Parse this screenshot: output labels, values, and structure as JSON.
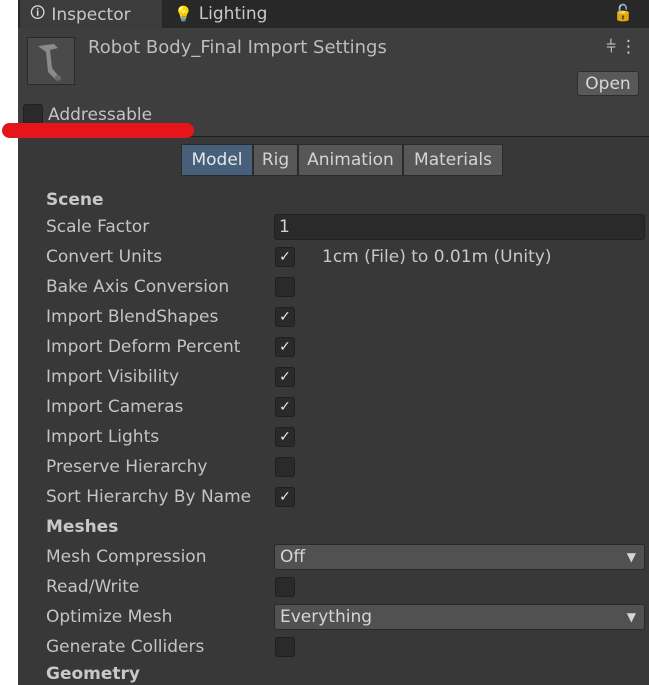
{
  "tabs": [
    {
      "label": "Inspector",
      "icon": "info-icon"
    },
    {
      "label": "Lighting",
      "icon": "bulb-icon"
    }
  ],
  "header": {
    "title": "Robot Body_Final Import Settings",
    "open_label": "Open",
    "addressable_label": "Addressable",
    "addressable_checked": false
  },
  "mode_tabs": [
    "Model",
    "Rig",
    "Animation",
    "Materials"
  ],
  "active_mode": "Model",
  "scene": {
    "section": "Scene",
    "scale_factor_label": "Scale Factor",
    "scale_factor_value": "1",
    "convert_units_label": "Convert Units",
    "convert_units_checked": true,
    "convert_units_note": "1cm (File) to 0.01m (Unity)",
    "bake_axis_label": "Bake Axis Conversion",
    "bake_axis_checked": false,
    "blendshapes_label": "Import BlendShapes",
    "blendshapes_checked": true,
    "deform_label": "Import Deform Percent",
    "deform_checked": true,
    "visibility_label": "Import Visibility",
    "visibility_checked": true,
    "cameras_label": "Import Cameras",
    "cameras_checked": true,
    "lights_label": "Import Lights",
    "lights_checked": true,
    "preserve_label": "Preserve Hierarchy",
    "preserve_checked": false,
    "sort_label": "Sort Hierarchy By Name",
    "sort_checked": true
  },
  "meshes": {
    "section": "Meshes",
    "compression_label": "Mesh Compression",
    "compression_value": "Off",
    "readwrite_label": "Read/Write",
    "readwrite_checked": false,
    "optimize_label": "Optimize Mesh",
    "optimize_value": "Everything",
    "colliders_label": "Generate Colliders",
    "colliders_checked": false
  },
  "geometry": {
    "section": "Geometry"
  },
  "colors": {
    "panel": "#383838",
    "active_tab": "#46607c",
    "annotation": "#e5161b"
  }
}
